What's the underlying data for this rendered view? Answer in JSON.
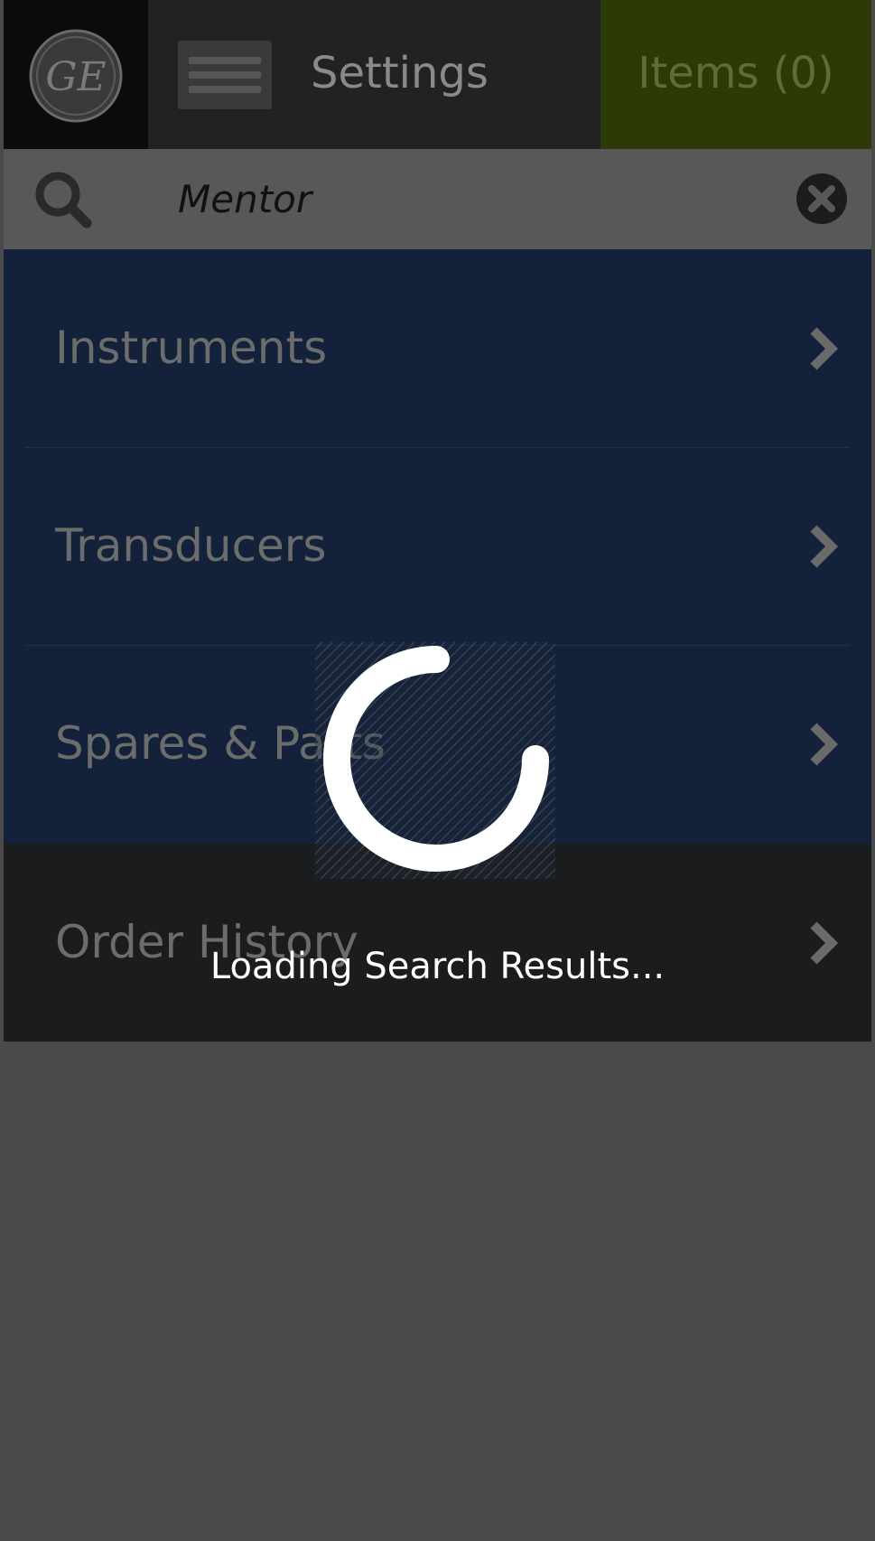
{
  "header": {
    "logo": "GE",
    "menu_icon": "hamburger-icon",
    "title": "Settings",
    "cart_label": "Items (0)",
    "cart_color": "#2b3a06"
  },
  "search": {
    "value": "Mentor",
    "search_icon": "search-icon",
    "clear_icon": "close-circle-icon"
  },
  "menu": {
    "items": [
      {
        "label": "Instruments",
        "icon": "chevron-right-icon"
      },
      {
        "label": "Transducers",
        "icon": "chevron-right-icon"
      },
      {
        "label": "Spares & Parts",
        "icon": "chevron-right-icon"
      },
      {
        "label": "Order History",
        "icon": "chevron-right-icon"
      }
    ]
  },
  "overlay": {
    "spinner_icon": "loading-spinner-icon",
    "message": "Loading Search Results..."
  },
  "colors": {
    "menu_bg": "#13213a",
    "page_bg": "#4a4a4a"
  }
}
